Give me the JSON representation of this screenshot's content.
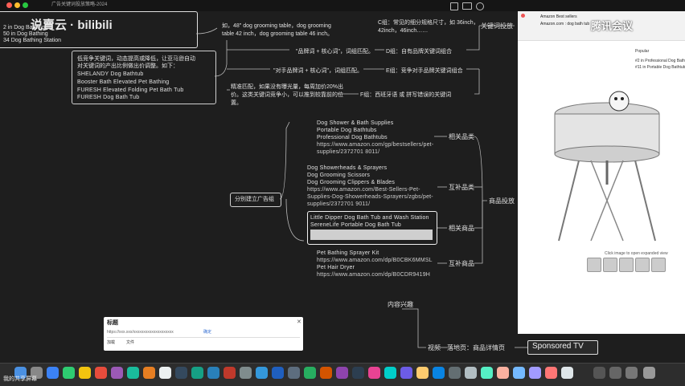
{
  "menubar": {
    "title": "广告关键词投放策略-2024"
  },
  "top_left": {
    "lines": [
      "2 in Dog Bathing",
      "50 in Dog Bathing",
      "34 Dog Bathing Station"
    ]
  },
  "watermark": {
    "text": "说賣云 · bilibili"
  },
  "brand_logo": {
    "text": "腾讯会议"
  },
  "note_top": {
    "text1": "如，48\" dog grooming table，dog grooming",
    "text2": "table 42 inch，dog grooming table 46 inch。"
  },
  "note_top_right": {
    "text1": "C组：常见的细分规格尺寸，如 36inch，",
    "text2": "42inch，46inch……"
  },
  "keyword_placement": {
    "label": "关键词投放"
  },
  "note_competitor": {
    "lines": [
      "低竞争关键词，动态提高或降低，让亚马逊自动",
      "对关键词的产出比例做出价调整。如下：",
      "SHELANDY Dog Bathtub",
      "Booster Bath Elevated Pet Bathing",
      "FURESH Elevated Folding Pet Bath Tub",
      "FURESH Dog Bath Tub"
    ]
  },
  "groups": {
    "d_left": "\"品牌词 + 核心词\"，词组匹配。",
    "d_right": "D组：自有品牌关键词组合",
    "e_left": "\"对手品牌词 + 核心词\"，词组匹配。",
    "e_right": "E组：竞争对手品牌关键词组合",
    "f_left1": "精准匹配，如果没有曝光量，每周加价20%出",
    "f_left2": "价。这类关键词竞争小，可以推到较靠前的位",
    "f_left3": "置。",
    "f_right": "F组：西班牙语 或 拼写错误的关键词"
  },
  "related_category": {
    "label": "相关品类",
    "lines": [
      "Dog Shower & Bath Supplies",
      "Portable Dog Bathtubs",
      "Professional Dog Bathtubs",
      "https://www.amazon.com/gp/bestsellers/pet-",
      "supplies/2372701 8011/"
    ]
  },
  "complementary_category": {
    "label": "互补品类",
    "lines": [
      "Dog Showerheads & Sprayers",
      "Dog Grooming Scissors",
      "Dog Grooming Clippers & Blades",
      "https://www.amazon.com/Best-Sellers-Pet-",
      "Supplies-Dog-Showerheads-Sprayers/zgbs/pet-",
      "supplies/2372701 9011/"
    ]
  },
  "ad_group_node": {
    "label": "分别建立广告组"
  },
  "product_placement": {
    "label": "商品投放"
  },
  "related_products": {
    "label": "相关商品",
    "lines": [
      "Little Dipper Dog Bath Tub and Wash Station",
      "SereneLife Portable Dog Bath Tub"
    ]
  },
  "complementary_products": {
    "label": "互补商品",
    "lines": [
      "Pet Bathing Sprayer Kit",
      "https://www.amazon.com/dp/B0CBK6MMSL",
      "Pet Hair Dryer",
      "https://www.amazon.com/dp/B0CDR9419H"
    ]
  },
  "content_interest": {
    "label": "内容兴趣"
  },
  "bottom_row": {
    "video": "视频",
    "placement": "落地页：商品详情页",
    "sponsored": "Sponsored TV"
  },
  "dialog": {
    "title": "标题",
    "line1": "https://xxx.xxx/xxxxxxxxxxxxxxxxxxxx",
    "btn": "确定",
    "opt_a": "加载",
    "opt_b": "文件"
  },
  "shop": {
    "nav1": "Amazon Best sellers",
    "nav2": "Amazon.com : dog bath tub",
    "caption": "Click image to open expanded view",
    "side1": "Popular",
    "side2": "#2 in Professional Dog Bath",
    "side3": "#11 in Portable Dog Bathtubs"
  },
  "bottom_status": {
    "text": "我的共享屏幕"
  },
  "colors": {
    "background": "#1e1e1e",
    "text": "#e0e0e0",
    "highlight": "#f5f5f5",
    "accent": "#2f6bd1"
  }
}
